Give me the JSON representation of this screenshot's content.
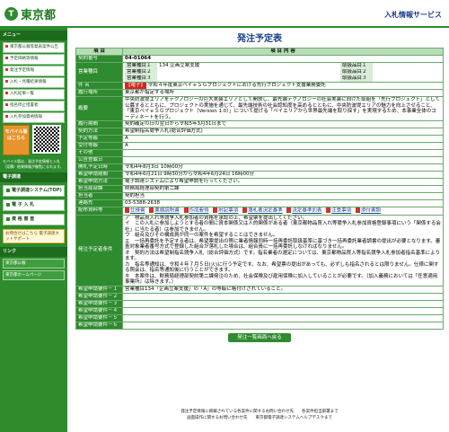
{
  "header": {
    "logo_mark": "T",
    "logo_text": "東京都",
    "service_title": "入札情報サービス"
  },
  "sidebar": {
    "menu_head": "メニュー",
    "items": [
      {
        "label": "東京都公報等発表案件公告"
      },
      {
        "label": "予定価格等情報"
      },
      {
        "label": "発注予定情報"
      },
      {
        "label": "入札・見積結果情報"
      },
      {
        "label": "入札結果一覧"
      },
      {
        "label": "指名停止措置者"
      },
      {
        "label": "入札参加資格情報"
      }
    ],
    "mobile_label": "モバイル版はこちら",
    "mobile_note": "モバイル版は、発注予定情報と入札（見積）結果情報が御覧になれます。",
    "links_head": "電子調達",
    "big_items": [
      {
        "label": "電子調達システム(TOP)"
      },
      {
        "label": "電 子 入 札"
      },
      {
        "label": "資 格 審 査"
      }
    ],
    "inquiry": "お問合せはこちら 電子調達ネットサポート",
    "links_head2": "リンク",
    "links": [
      {
        "label": "東京都公報"
      },
      {
        "label": "東京都ホームページ"
      }
    ]
  },
  "page": {
    "title": "発注予定表",
    "col_item": "項 目",
    "col_content": "項 目 内 容"
  },
  "details": {
    "contract_no_label": "契約番号",
    "contract_no": "04-01064",
    "business_type_label": "営業種目",
    "business_rows": [
      {
        "label": "営業種目１",
        "value": "134 企画立案支援",
        "rank_label": "取扱品目１",
        "rank": ""
      },
      {
        "label": "営業種目２",
        "value": "",
        "rank_label": "取扱品目２",
        "rank": ""
      },
      {
        "label": "営業種目３",
        "value": "",
        "rank_label": "取扱品目３",
        "rank": ""
      }
    ],
    "name_label": "件 名",
    "name_tag": "【電子】",
    "name": "令和４年度東京ベイｅＳＧプロジェクトにおける先行プロジェクト支援業務委託",
    "location_label": "履行場所",
    "location": "東京都が指定する場所",
    "summary_label": "概要",
    "summary": "中央防波堤エリアをテクノロジーの巨大実装エリアとして開放し、最先端テクノロジーの社会実装に向けた取組を「先行プロジェクト」として公募するとともに、プロジェクトの実施を通じて、最先端技術の社会認知度を高めるとともに、中央防波堤エリアの魅力を向上させること、「東京ベイｅＳＧプロジェクト（Version 1.0）」について提げる「ベイエリアから世界最先端を取り探す」を実現するため、本事業全体のコーディネートを行う。",
    "period_label": "履行期間",
    "period": "契約確定の日の翌日から令和5年3月31日まで",
    "method_label": "契約方法",
    "method": "希望制指名競争入札(総合評価方式)",
    "grade_label": "予定等級",
    "grade": "A",
    "recv_grade_label": "受付等級",
    "recv_grade": "A",
    "other_label": "その他",
    "other": "",
    "notice_date_label": "公告登載日",
    "notice_date": "",
    "open_date_label": "開札予定日時",
    "open_date": "令和4年8月3日 10時00分",
    "apply_label": "希望申請期間",
    "apply": "令和4年6月21日 9時30分から令和4年6月24日 16時00分",
    "apply_method_label": "希望申請方法",
    "apply_method": "電子調達システムにより希望申請を行ってください。",
    "dept_label": "担当局部課",
    "dept": "財務局経理部契約第二課",
    "person_label": "担当者",
    "person": "契約担当",
    "tel_label": "連絡先",
    "tel": "03-5388-2638",
    "docs_label": "配布資料等",
    "docs": [
      "仕様書",
      "業務説明書",
      "作成要領",
      "附記事項",
      "落札者決定基準",
      "決定基準別表",
      "注意事項",
      "添付書類"
    ],
    "conditions_label": "発注予定者条件",
    "conditions": "ア　物品買入れ等競争入札参加者の資格を承認の上、希望票を提出してください。\nイ　この入札に参加しようとする者の間に資本関係又は人的関係がある者（東京都物品買入れ等競争入札参加資格登録事項にいう「関係する会社」に当たる者）は参加できません。\nウ　組合及びその構成員が同一の案件を希望することはできません。\nエ　一括再委託を予定する者は、希望票提出の際に業者情報同時一括再委託取扱基準に基づき一括再委託業者調書の提出が必要となります。審査対象業者番号方式で登録した組合が落札した場合は、組合員に一括再委託しなければなりません。\nオ　契約方法は希望制指名競争入札（総合評価方式）です。指名業者の選定については、東京都物品買入等指名競争入札参加者指名基準によります。\nカ　指名等通知は、令和４年７月５日(火)に行う予定です。なお、希望票の提出があっても、必ずしも指名されるとは限りません。仕様に関する照会は、指名等通知後に行うことができます。\nキ　本案件は、財務局経理部契約第二課発注のため、社会保険及び雇用保険に加入していることが必要です。（加入義務においては『任意適用事業所』は除きます。）",
    "req_rows": [
      {
        "label": "希望申請要件－１",
        "value": "営業種目134「企画立案支援」の「A」の等級に格付けされていること。"
      },
      {
        "label": "希望申請要件－２",
        "value": ""
      },
      {
        "label": "希望申請要件－３",
        "value": ""
      },
      {
        "label": "希望申請要件－４",
        "value": ""
      },
      {
        "label": "希望申請要件－５",
        "value": ""
      },
      {
        "label": "希望申請要件－６",
        "value": ""
      }
    ]
  },
  "back_button": "発注一覧画面へ戻る",
  "footer": {
    "line1": "発注予定情報に掲載されている各案件に関するお問い合わせ先　　各案件担当部署まで",
    "line2": "画面操作に関するお問い合わせ先　　東京都電子調達システムヘルプデスクまで"
  },
  "colors": {
    "brand_green": "#2e8b2e",
    "title_blue": "#1a3e8c",
    "tag_red": "#dd2222"
  }
}
